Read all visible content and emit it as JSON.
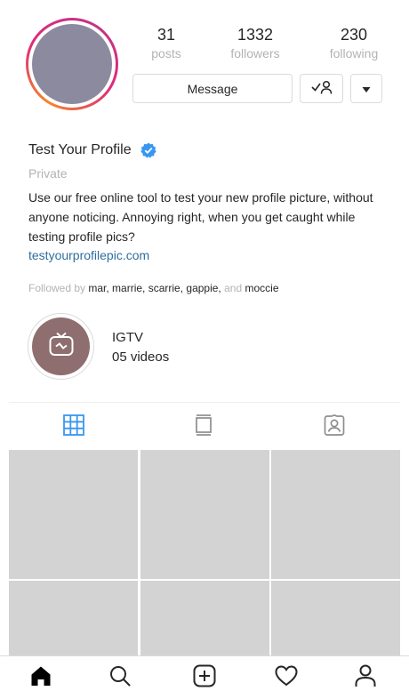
{
  "profile": {
    "stats": [
      {
        "value": "31",
        "label": "posts"
      },
      {
        "value": "1332",
        "label": "followers"
      },
      {
        "value": "230",
        "label": "following"
      }
    ],
    "buttons": {
      "message_label": "Message"
    },
    "name": "Test Your Profile",
    "category": "Private",
    "bio": "Use our free online tool to test your new profile picture, without anyone noticing. Annoying right, when you get caught while testing profile pics?",
    "link": "testyourprofilepic.com",
    "followed_by_prefix": "Followed by",
    "followed_by_names": "mar, marrie, scarrie, gappie,",
    "followed_by_and": "and",
    "followed_by_last": "moccie"
  },
  "highlight": {
    "title": "IGTV",
    "subtitle": "05 videos"
  },
  "colors": {
    "accent": "#3897f0",
    "link": "#2f6e9e",
    "avatar": "#8c8a9e",
    "highlight": "#8e6e6e",
    "grid_cell": "#d3d3d3"
  },
  "icons": {
    "verified": "verified-badge-icon",
    "follow_status": "following-check-person-icon",
    "dropdown": "caret-down-icon",
    "igtv": "igtv-icon",
    "tabs": [
      "grid-icon",
      "igtv-feed-icon",
      "tagged-icon"
    ],
    "nav": [
      "home-icon",
      "search-icon",
      "new-post-icon",
      "activity-heart-icon",
      "profile-icon"
    ]
  }
}
